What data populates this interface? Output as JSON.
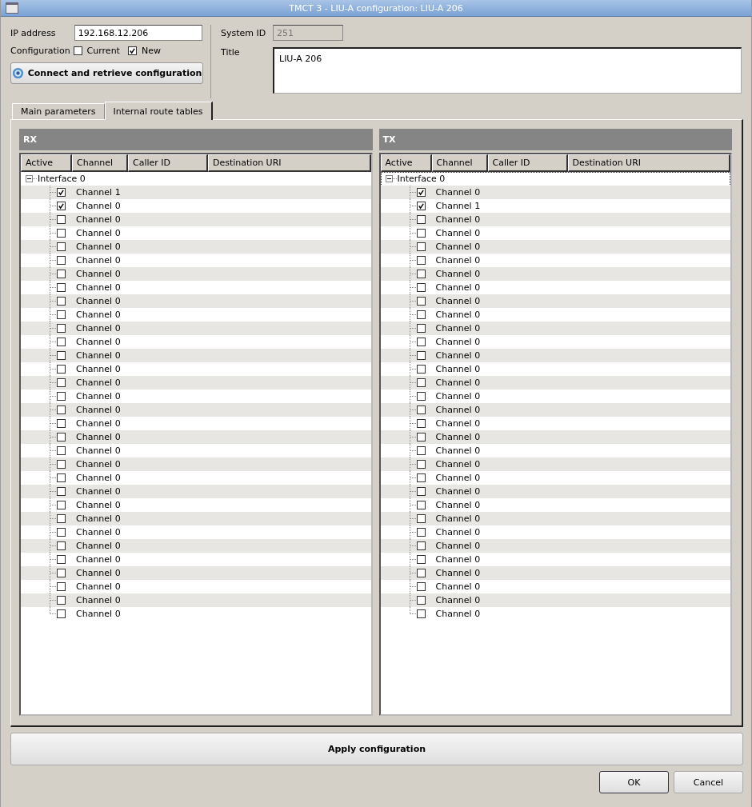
{
  "window": {
    "title": "TMCT 3 - LIU-A configuration: LIU-A 206"
  },
  "ip_address": {
    "label": "IP address",
    "value": "192.168.12.206"
  },
  "configuration": {
    "label": "Configuration",
    "options": [
      {
        "label": "Current",
        "checked": false
      },
      {
        "label": "New",
        "checked": true
      }
    ]
  },
  "connect_button": "Connect and retrieve configuration",
  "system_id": {
    "label": "System ID",
    "value": "251",
    "disabled": true
  },
  "title_field": {
    "label": "Title",
    "value": "LIU-A 206"
  },
  "tabs": [
    {
      "label": "Main parameters",
      "selected": false
    },
    {
      "label": "Internal route tables",
      "selected": true
    }
  ],
  "panels": [
    {
      "title": "RX",
      "columns": [
        "Active",
        "Channel",
        "Caller ID",
        "Destination URI"
      ],
      "tree": [
        {
          "label": "Interface 0",
          "expanded": true,
          "focused": false,
          "children": [
            {
              "label": "Channel 1",
              "checked": true
            },
            {
              "label": "Channel 0",
              "checked": true
            },
            {
              "label": "Channel 0",
              "checked": false
            },
            {
              "label": "Channel 0",
              "checked": false
            },
            {
              "label": "Channel 0",
              "checked": false
            },
            {
              "label": "Channel 0",
              "checked": false
            },
            {
              "label": "Channel 0",
              "checked": false
            },
            {
              "label": "Channel 0",
              "checked": false
            },
            {
              "label": "Channel 0",
              "checked": false
            },
            {
              "label": "Channel 0",
              "checked": false
            },
            {
              "label": "Channel 0",
              "checked": false
            },
            {
              "label": "Channel 0",
              "checked": false
            },
            {
              "label": "Channel 0",
              "checked": false
            },
            {
              "label": "Channel 0",
              "checked": false
            },
            {
              "label": "Channel 0",
              "checked": false
            },
            {
              "label": "Channel 0",
              "checked": false
            },
            {
              "label": "Channel 0",
              "checked": false
            },
            {
              "label": "Channel 0",
              "checked": false
            },
            {
              "label": "Channel 0",
              "checked": false
            },
            {
              "label": "Channel 0",
              "checked": false
            },
            {
              "label": "Channel 0",
              "checked": false
            },
            {
              "label": "Channel 0",
              "checked": false
            },
            {
              "label": "Channel 0",
              "checked": false
            },
            {
              "label": "Channel 0",
              "checked": false
            },
            {
              "label": "Channel 0",
              "checked": false
            },
            {
              "label": "Channel 0",
              "checked": false
            },
            {
              "label": "Channel 0",
              "checked": false
            },
            {
              "label": "Channel 0",
              "checked": false
            },
            {
              "label": "Channel 0",
              "checked": false
            },
            {
              "label": "Channel 0",
              "checked": false
            },
            {
              "label": "Channel 0",
              "checked": false
            },
            {
              "label": "Channel 0",
              "checked": false
            }
          ]
        }
      ]
    },
    {
      "title": "TX",
      "columns": [
        "Active",
        "Channel",
        "Caller ID",
        "Destination URI"
      ],
      "tree": [
        {
          "label": "Interface 0",
          "expanded": true,
          "focused": true,
          "children": [
            {
              "label": "Channel 0",
              "checked": true
            },
            {
              "label": "Channel 1",
              "checked": true
            },
            {
              "label": "Channel 0",
              "checked": false
            },
            {
              "label": "Channel 0",
              "checked": false
            },
            {
              "label": "Channel 0",
              "checked": false
            },
            {
              "label": "Channel 0",
              "checked": false
            },
            {
              "label": "Channel 0",
              "checked": false
            },
            {
              "label": "Channel 0",
              "checked": false
            },
            {
              "label": "Channel 0",
              "checked": false
            },
            {
              "label": "Channel 0",
              "checked": false
            },
            {
              "label": "Channel 0",
              "checked": false
            },
            {
              "label": "Channel 0",
              "checked": false
            },
            {
              "label": "Channel 0",
              "checked": false
            },
            {
              "label": "Channel 0",
              "checked": false
            },
            {
              "label": "Channel 0",
              "checked": false
            },
            {
              "label": "Channel 0",
              "checked": false
            },
            {
              "label": "Channel 0",
              "checked": false
            },
            {
              "label": "Channel 0",
              "checked": false
            },
            {
              "label": "Channel 0",
              "checked": false
            },
            {
              "label": "Channel 0",
              "checked": false
            },
            {
              "label": "Channel 0",
              "checked": false
            },
            {
              "label": "Channel 0",
              "checked": false
            },
            {
              "label": "Channel 0",
              "checked": false
            },
            {
              "label": "Channel 0",
              "checked": false
            },
            {
              "label": "Channel 0",
              "checked": false
            },
            {
              "label": "Channel 0",
              "checked": false
            },
            {
              "label": "Channel 0",
              "checked": false
            },
            {
              "label": "Channel 0",
              "checked": false
            },
            {
              "label": "Channel 0",
              "checked": false
            },
            {
              "label": "Channel 0",
              "checked": false
            },
            {
              "label": "Channel 0",
              "checked": false
            },
            {
              "label": "Channel 0",
              "checked": false
            }
          ]
        }
      ]
    }
  ],
  "apply_button": "Apply configuration",
  "buttons": [
    "OK",
    "Cancel"
  ]
}
